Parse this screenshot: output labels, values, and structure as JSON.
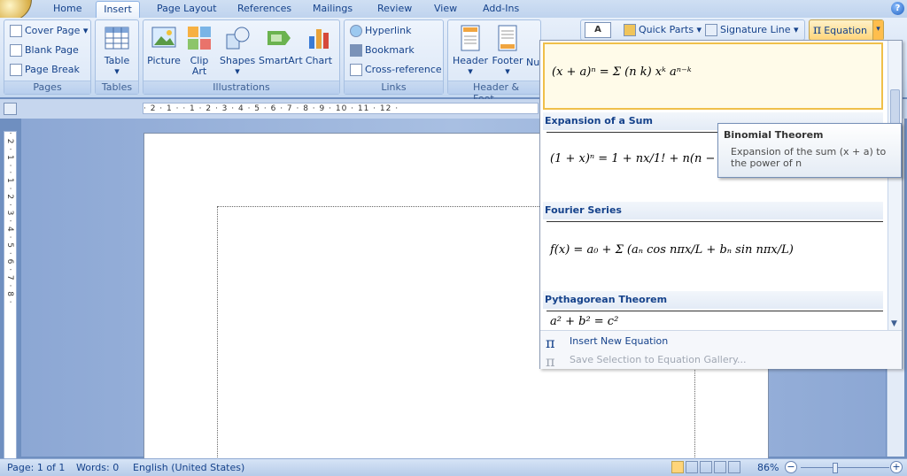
{
  "tabs": [
    "Home",
    "Insert",
    "Page Layout",
    "References",
    "Mailings",
    "Review",
    "View",
    "Add-Ins"
  ],
  "active_tab": "Insert",
  "ribbon": {
    "pages": {
      "label": "Pages",
      "cover_page": "Cover Page",
      "blank_page": "Blank Page",
      "page_break": "Page Break"
    },
    "tables": {
      "label": "Tables",
      "table": "Table"
    },
    "illustrations": {
      "label": "Illustrations",
      "picture": "Picture",
      "clip_art_1": "Clip",
      "clip_art_2": "Art",
      "shapes": "Shapes",
      "smartart": "SmartArt",
      "chart": "Chart"
    },
    "links": {
      "label": "Links",
      "hyperlink": "Hyperlink",
      "bookmark": "Bookmark",
      "cross_reference": "Cross-reference"
    },
    "header_footer": {
      "label": "Header & Foot",
      "header": "Header",
      "footer": "Footer",
      "page_number_partial": "Nu"
    },
    "text": {
      "quick_parts": "Quick Parts",
      "signature_line": "Signature Line"
    },
    "symbols": {
      "equation": "Equation",
      "pi": "π"
    }
  },
  "ruler_text": "· 2 · 1 ·   · 1 · 2 · 3 · 4 · 5 · 6 · 7 · 8 · 9 · 10 · 11 · 12 ·",
  "vruler_text": "· 2 · 1 ·   · 1 · 2 · 3 · 4 · 5 · 6 · 7 · 8 ·",
  "gallery": {
    "items": [
      {
        "title": "",
        "equation": "(x + a)ⁿ = Σ (n k) xᵏ aⁿ⁻ᵏ"
      },
      {
        "title": "Expansion of a Sum",
        "equation": "(1 + x)ⁿ = 1 + nx/1! + n(n − 1)/2!"
      },
      {
        "title": "Fourier Series",
        "equation": "f(x) = a₀ + Σ (aₙ cos nπx/L + bₙ sin nπx/L)"
      },
      {
        "title": "Pythagorean Theorem",
        "equation": "a² + b² = c²"
      }
    ],
    "insert_new": "Insert New Equation",
    "save_selection": "Save Selection to Equation Gallery..."
  },
  "tooltip": {
    "title": "Binomial Theorem",
    "body": "Expansion of the sum (x + a) to the power of n"
  },
  "status": {
    "page": "Page: 1 of 1",
    "words": "Words: 0",
    "language": "English (United States)",
    "zoom": "86%"
  }
}
